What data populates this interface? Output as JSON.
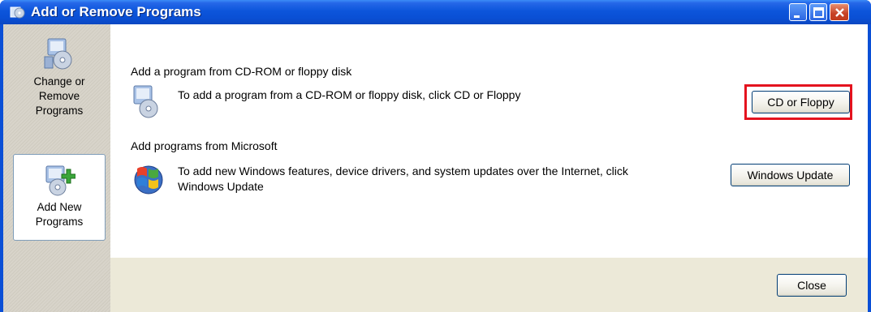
{
  "window": {
    "title": "Add or Remove Programs"
  },
  "sidebar": {
    "items": [
      {
        "label_line1": "Change or",
        "label_line2": "Remove",
        "label_line3": "Programs",
        "icon": "change-remove-programs-icon",
        "selected": false
      },
      {
        "label_line1": "Add New",
        "label_line2": "Programs",
        "icon": "add-new-programs-icon",
        "selected": true
      }
    ]
  },
  "main": {
    "cd_section": {
      "heading": "Add a program from CD-ROM or floppy disk",
      "description": "To add a program from a CD-ROM or floppy disk, click CD or Floppy",
      "button_label": "CD or Floppy",
      "icon": "cd-floppy-install-icon"
    },
    "ms_section": {
      "heading": "Add programs from Microsoft",
      "description_line1": "To add new Windows features, device drivers, and system updates over the Internet, click",
      "description_line2": "Windows Update",
      "button_label": "Windows Update",
      "icon": "windows-logo-icon"
    }
  },
  "footer": {
    "close_label": "Close"
  },
  "colors": {
    "titlebar": "#0a4fd4",
    "highlight_border": "#e4131e",
    "panel": "#ece9d8"
  }
}
